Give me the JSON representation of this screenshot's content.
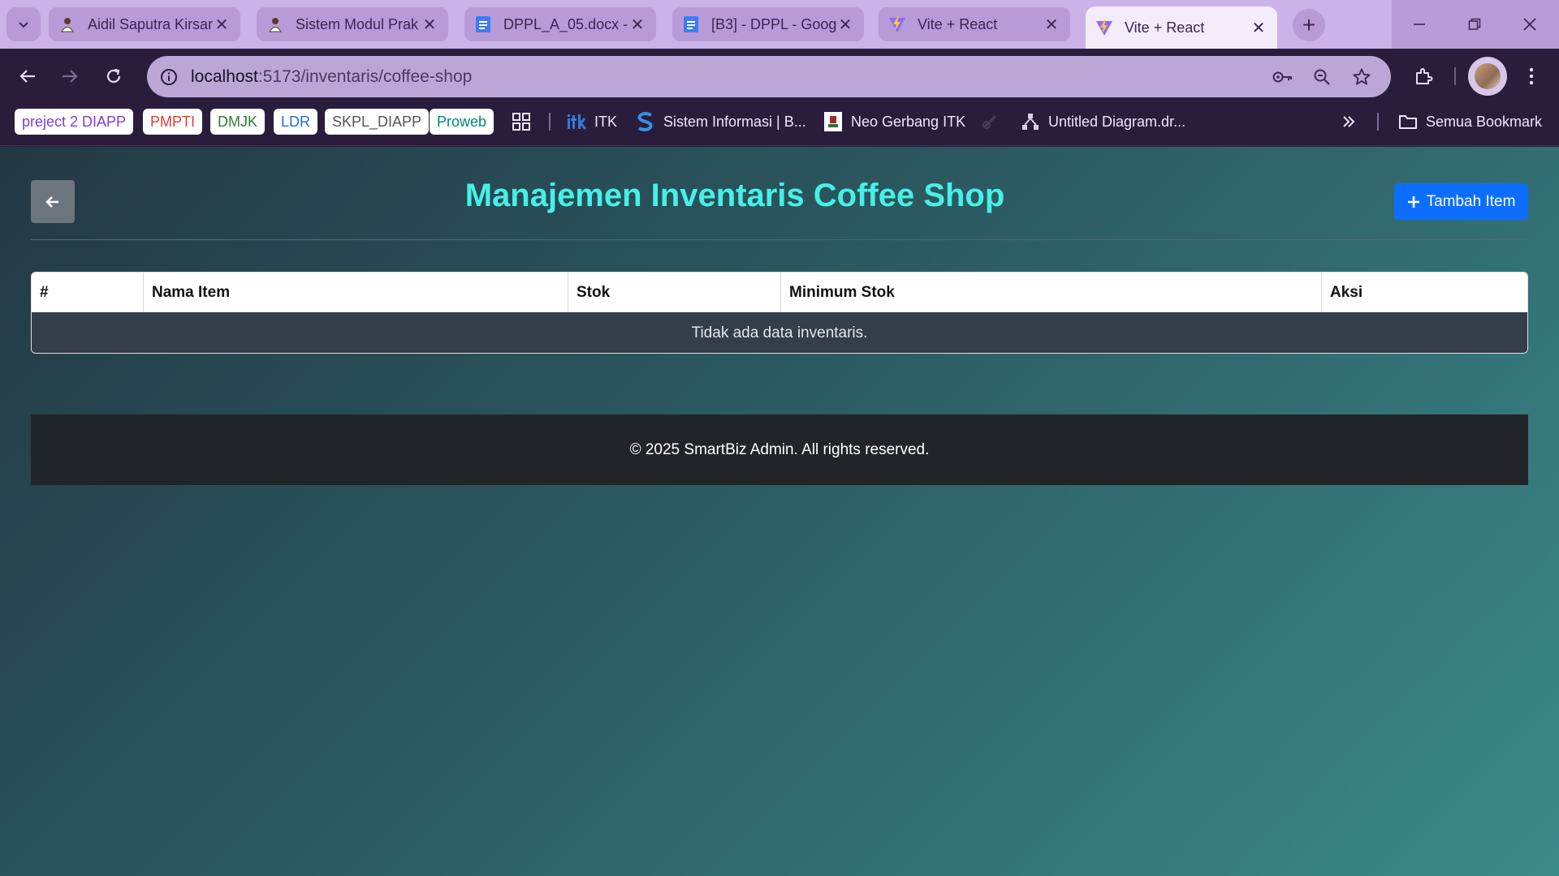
{
  "browser": {
    "tabs": [
      {
        "title": "Aidil Saputra Kirsan",
        "icon": "profile-favicon",
        "active": false
      },
      {
        "title": "Sistem Modul Prak",
        "icon": "profile-favicon",
        "active": false
      },
      {
        "title": "DPPL_A_05.docx - ",
        "icon": "docs-favicon",
        "active": false
      },
      {
        "title": "[B3] - DPPL - Goog",
        "icon": "docs-favicon",
        "active": false
      },
      {
        "title": "Vite + React",
        "icon": "vite-favicon",
        "active": false
      },
      {
        "title": "Vite + React",
        "icon": "vite-favicon",
        "active": true
      }
    ],
    "url_host": "localhost",
    "url_path": ":5173/inventaris/coffee-shop",
    "bookmark_chips": [
      {
        "label": "preject 2 DIAPP",
        "color": "#7b3fd6"
      },
      {
        "label": "PMPTI",
        "color": "#e53935"
      },
      {
        "label": "DMJK",
        "color": "#2e7d32"
      },
      {
        "label": "LDR",
        "color": "#1e6fd8"
      },
      {
        "label": "SKPL_DIAPP",
        "color": "#555555"
      },
      {
        "label": "Proweb",
        "color": "#00897b"
      }
    ],
    "bookmarks": [
      {
        "label": "ITK",
        "icon": "itk-icon"
      },
      {
        "label": "Sistem Informasi | B...",
        "icon": "si-icon"
      },
      {
        "label": "Neo Gerbang ITK",
        "icon": "neo-icon"
      },
      {
        "label": "Untitled Diagram.dr...",
        "icon": "diagram-icon"
      }
    ],
    "all_bookmarks_label": "Semua Bookmark"
  },
  "page": {
    "title": "Manajemen Inventaris Coffee Shop",
    "add_button_label": "Tambah Item",
    "table": {
      "columns": [
        "#",
        "Nama Item",
        "Stok",
        "Minimum Stok",
        "Aksi"
      ],
      "empty_message": "Tidak ada data inventaris."
    },
    "footer_text": "© 2025 SmartBiz Admin. All rights reserved."
  },
  "colors": {
    "accent_title": "#47f0e6",
    "primary_button": "#0d6efd",
    "back_button": "#6c757d",
    "footer_bg": "#212529"
  }
}
